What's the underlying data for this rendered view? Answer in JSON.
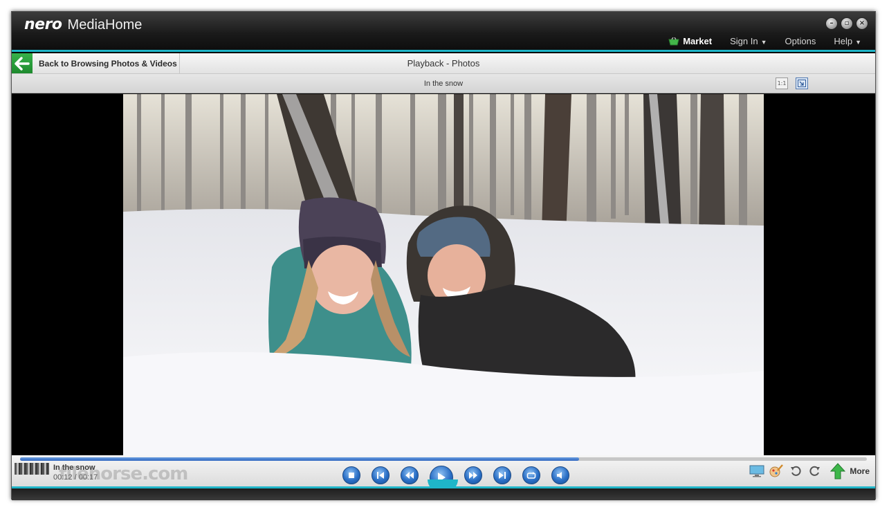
{
  "titlebar": {
    "brand": "nero",
    "app_name": "MediaHome",
    "menu": {
      "market": "Market",
      "sign_in": "Sign In",
      "options": "Options",
      "help": "Help"
    }
  },
  "navbar": {
    "back_label": "Back to Browsing Photos & Videos",
    "title": "Playback - Photos"
  },
  "infobar": {
    "item_title": "In the snow",
    "actual_size_label": "1:1"
  },
  "player": {
    "now_playing_title": "In the snow",
    "time": "00:12 / 00:17",
    "progress": 0.66,
    "more_label": "More"
  },
  "watermark": "filehorse.com",
  "colors": {
    "accent_cyan": "#1fb5c8",
    "back_green": "#2aa03c",
    "transport_blue": "#2a6fc6"
  }
}
